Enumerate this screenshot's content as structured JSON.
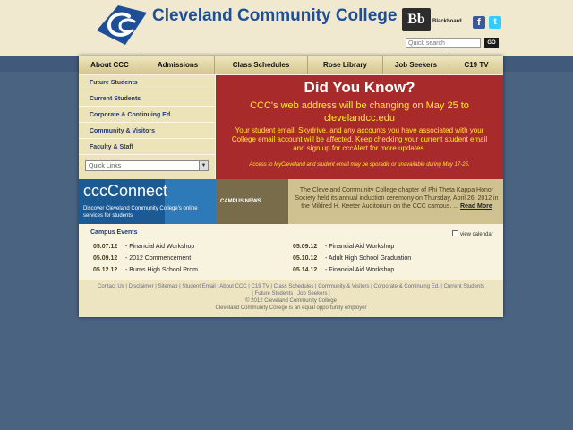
{
  "header": {
    "college_name": "Cleveland Community College",
    "blackboard_logo": "Bb",
    "blackboard_label": "Blackboard",
    "facebook_icon": "facebook-icon",
    "twitter_icon": "twitter-icon",
    "search_placeholder": "Quick search",
    "search_button": "GO"
  },
  "nav": {
    "tabs": [
      "About CCC",
      "Admissions",
      "Class Schedules",
      "Rose Library",
      "Job Seekers",
      "C19 TV"
    ]
  },
  "sidebar": {
    "items": [
      "Future Students",
      "Current Students",
      "Corporate & Continuing Ed.",
      "Community & Visitors",
      "Faculty & Staff"
    ],
    "quick_links": "Quick Links"
  },
  "did_you_know": {
    "title": "Did You Know?",
    "headline": "CCC's web address will be changing on May 25 to clevelandcc.edu",
    "body": "Your student email, Skydrive, and any accounts you have associated with your College email account will be affected. Keep checking your current student email and sign up for cccAlert for more updates.",
    "note": "Access to MyCleveland and student email may be sporadic or unavailable during May 17-25."
  },
  "ccc_connect": {
    "title": "cccConnect",
    "subtitle": "Discover Cleveland Community College's online services for students"
  },
  "campus_news": {
    "label": "CAMPUS NEWS",
    "text": "The Cleveland Community College chapter of Phi Theta Kappa Honor Society held its annual induction ceremony on Thursday, April 26, 2012 in the Mildred H. Keeter Auditorium on the CCC campus. ...",
    "read_more": "Read More"
  },
  "campus_events": {
    "title": "Campus Events",
    "view_calendar": "view calendar",
    "left": [
      {
        "date": "05.07.12",
        "name": "- Financial Aid Workshop"
      },
      {
        "date": "05.09.12",
        "name": "- 2012 Commencement"
      },
      {
        "date": "05.12.12",
        "name": "- Burns High School Prom"
      }
    ],
    "right": [
      {
        "date": "05.09.12",
        "name": "- Financial Aid Workshop"
      },
      {
        "date": "05.10.12",
        "name": "- Adult High School Graduation"
      },
      {
        "date": "05.14.12",
        "name": "- Financial Aid Workshop"
      }
    ]
  },
  "footer": {
    "links_line1": "Contact Us | Disclaimer | Sitemap | Student Email | About CCC | C19 TV | Class Schedules | Community & Visitors | Corporate & Continuing Ed. | Current Students",
    "links_line2": "| Future Students | Job Seekers |",
    "copyright": "© 2012 Cleveland Community College",
    "eeo": "Cleveland Community College is an equal opportunity employer"
  },
  "colors": {
    "brand_blue": "#1e4f96",
    "banner_red": "#a92a2a",
    "banner_yellow": "#ffea2a",
    "page_cream": "#f7f3df",
    "background_slate": "#4a6380"
  }
}
